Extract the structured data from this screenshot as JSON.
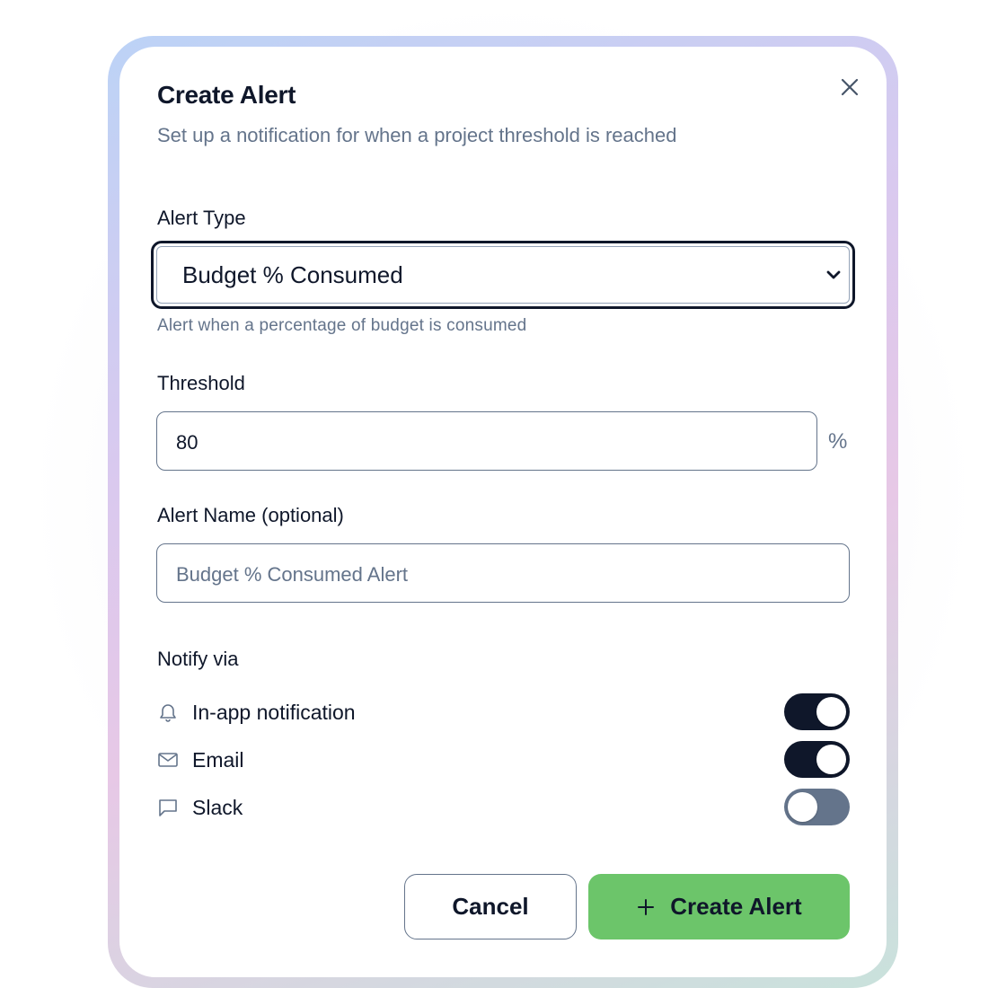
{
  "dialog": {
    "title": "Create Alert",
    "subtitle": "Set up a notification for when a project threshold is reached"
  },
  "alert_type": {
    "label": "Alert Type",
    "selected": "Budget % Consumed",
    "hint": "Alert when a percentage of budget is consumed"
  },
  "threshold": {
    "label": "Threshold",
    "value": "80",
    "unit": "%"
  },
  "alert_name": {
    "label": "Alert Name (optional)",
    "placeholder": "Budget % Consumed Alert"
  },
  "notify": {
    "label": "Notify via",
    "channels": [
      {
        "label": "In-app notification",
        "icon": "bell-icon",
        "enabled": true
      },
      {
        "label": "Email",
        "icon": "mail-icon",
        "enabled": true
      },
      {
        "label": "Slack",
        "icon": "chat-icon",
        "enabled": false
      }
    ]
  },
  "actions": {
    "cancel_label": "Cancel",
    "create_label": "Create Alert",
    "create_icon": "plus-icon"
  },
  "colors": {
    "primary_dark": "#0f172a",
    "accent_green": "#6cc56a",
    "muted": "#64748b"
  }
}
